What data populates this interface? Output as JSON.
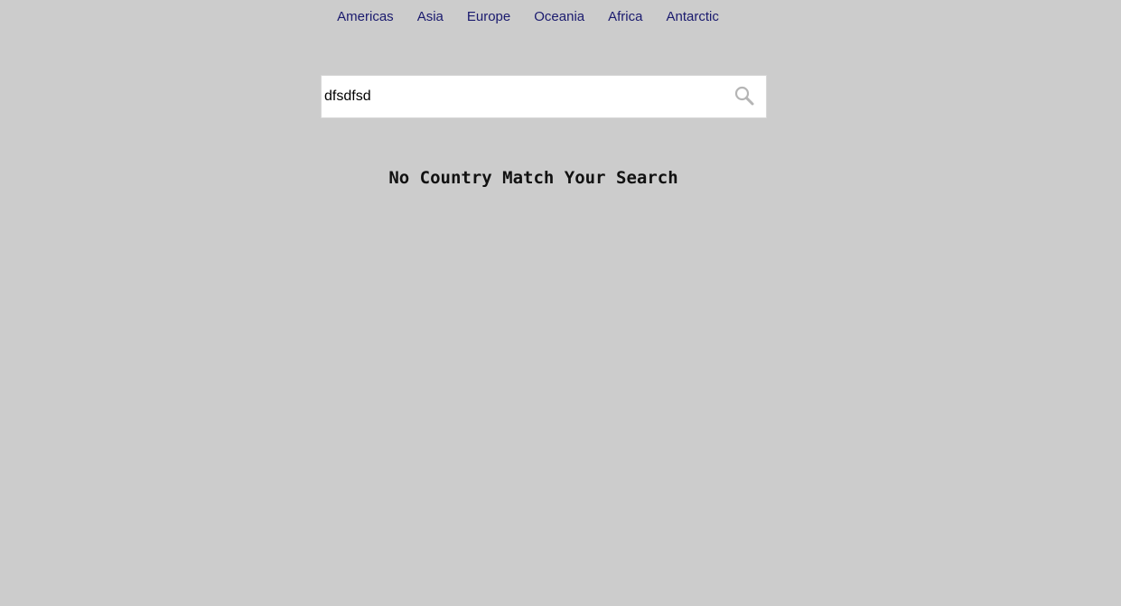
{
  "nav": {
    "regions": [
      "Americas",
      "Asia",
      "Europe",
      "Oceania",
      "Africa",
      "Antarctic"
    ]
  },
  "search": {
    "value": "dfsdfsd",
    "icon": "search-icon"
  },
  "results": {
    "empty_message": "No Country Match Your Search"
  },
  "colors": {
    "background": "#cccccc",
    "nav_link": "#1a1a6e",
    "search_icon": "#b5b5b5"
  }
}
